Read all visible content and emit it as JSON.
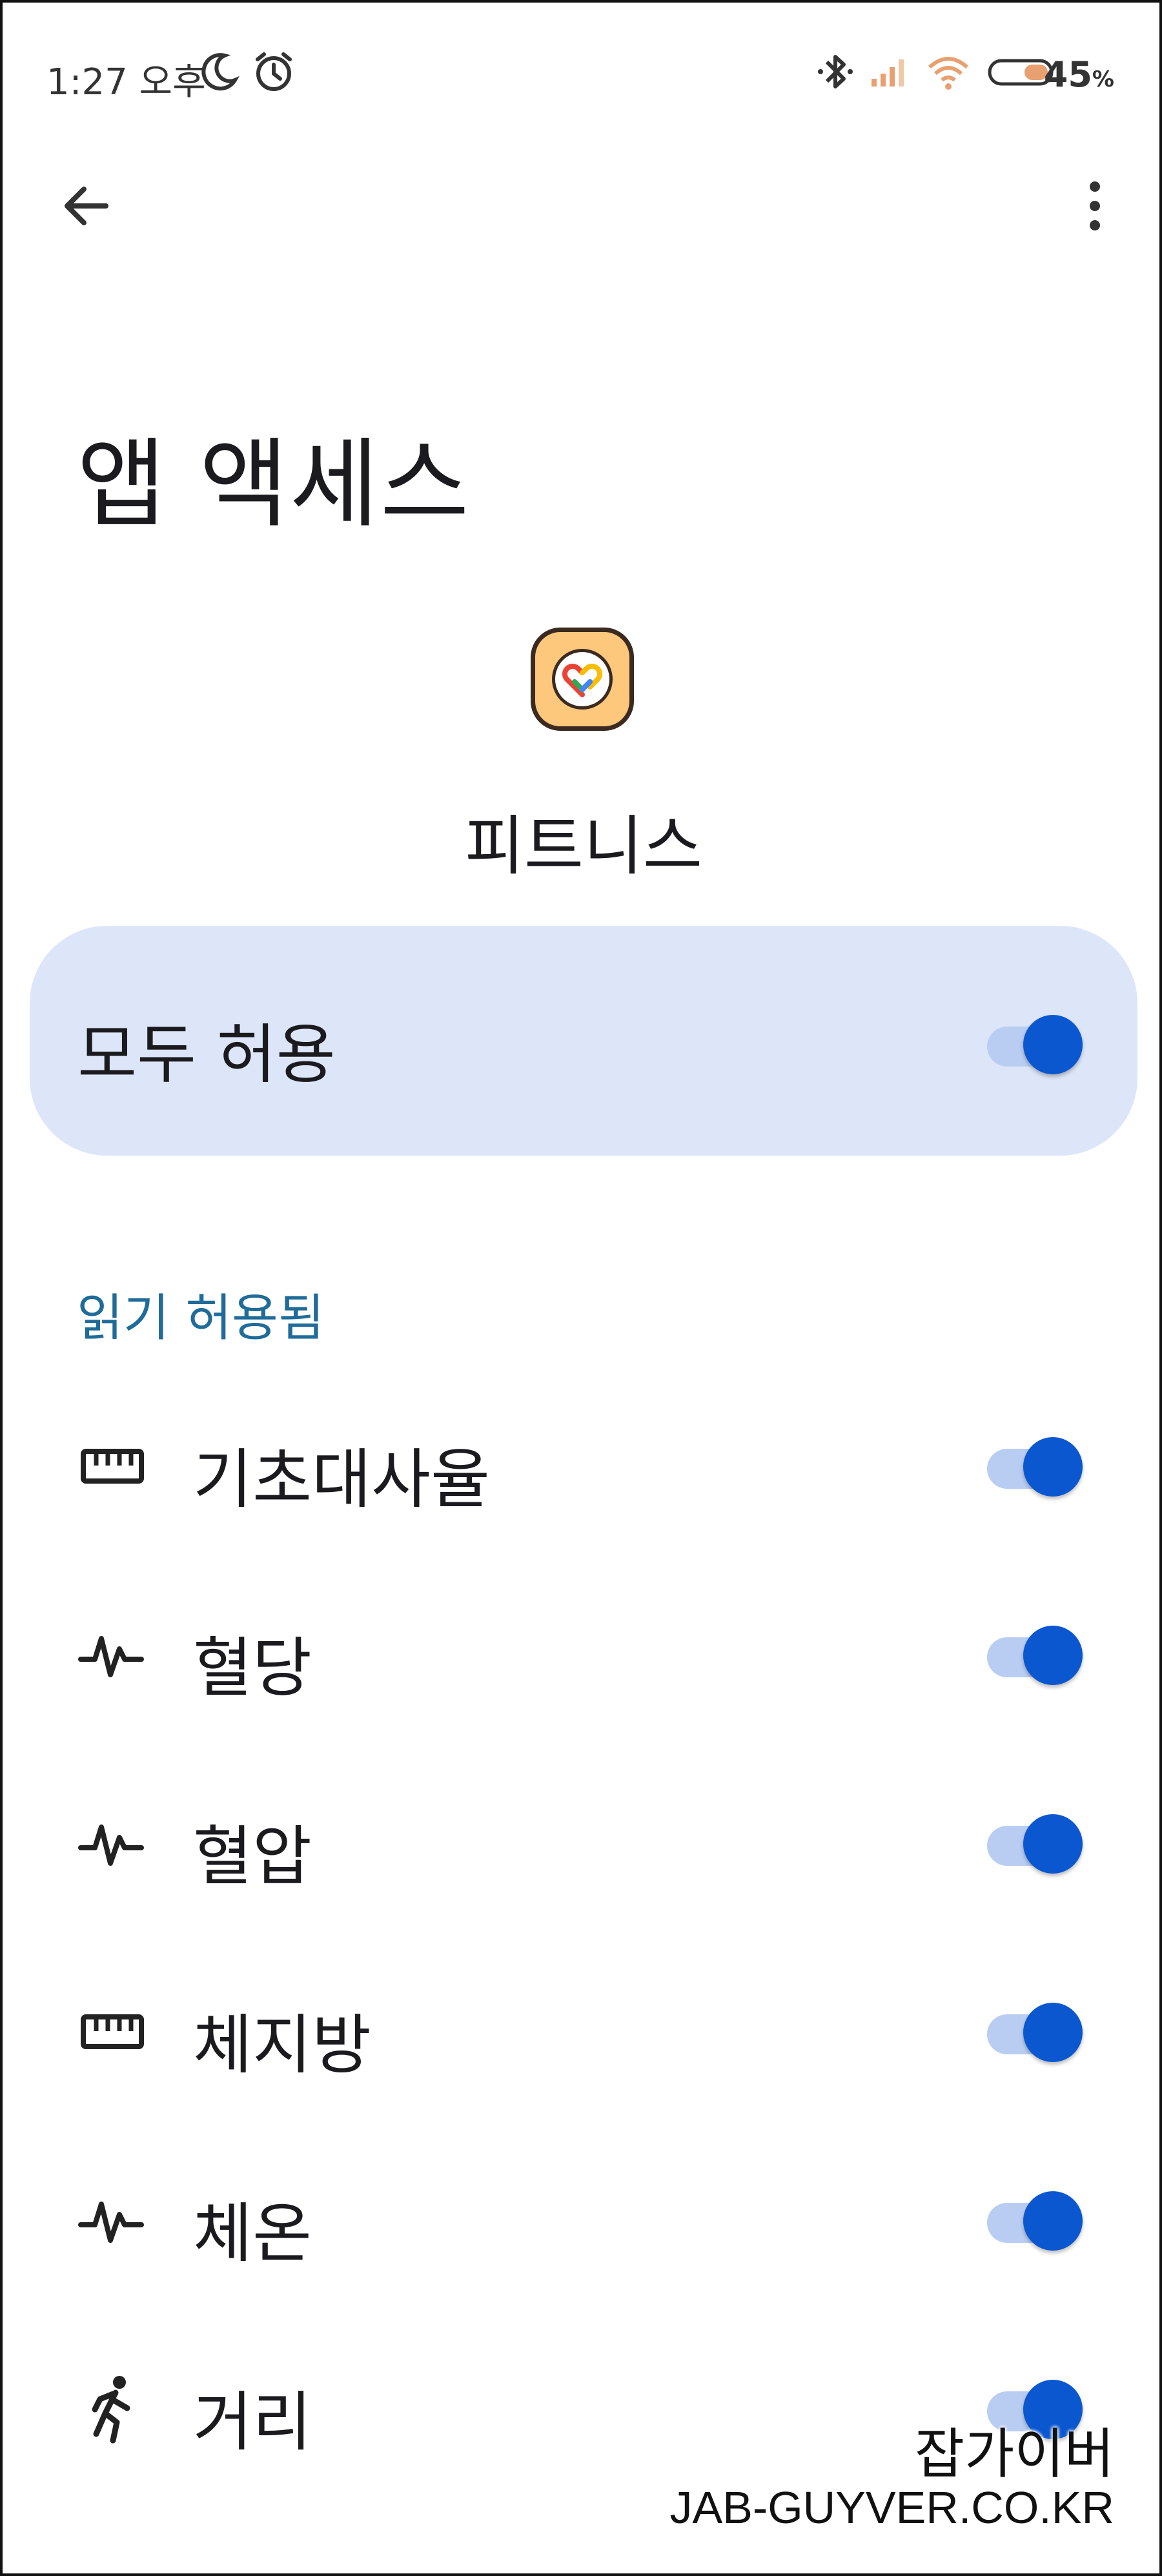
{
  "status_bar": {
    "time": "1:27 오후",
    "battery_percent": "45",
    "battery_unit": "%",
    "icons": [
      "moon-icon",
      "alarm-icon",
      "bluetooth-icon",
      "signal-icon",
      "wifi-icon",
      "battery-icon"
    ]
  },
  "app_bar": {
    "back_icon": "arrow-left-icon",
    "menu_icon": "more-vert-icon"
  },
  "page": {
    "title": "앱 액세스",
    "app_name": "피트니스",
    "app_icon": "google-fit-heart-icon"
  },
  "allow_all": {
    "label": "모두 허용",
    "on": true
  },
  "section": {
    "header": "읽기 허용됨"
  },
  "permissions": [
    {
      "label": "기초대사율",
      "icon": "ruler-icon",
      "on": true
    },
    {
      "label": "혈당",
      "icon": "vitals-icon",
      "on": true
    },
    {
      "label": "혈압",
      "icon": "vitals-icon",
      "on": true
    },
    {
      "label": "체지방",
      "icon": "ruler-icon",
      "on": true
    },
    {
      "label": "체온",
      "icon": "vitals-icon",
      "on": true
    },
    {
      "label": "거리",
      "icon": "running-icon",
      "on": true
    }
  ],
  "watermark": {
    "name": "잡가이버",
    "url": "JAB-GUYVER.CO.KR"
  },
  "colors": {
    "accent": "#0b57d0",
    "card_bg": "#dde6f8",
    "section_header": "#1f6b99",
    "app_icon_bg": "#fdc77c"
  }
}
